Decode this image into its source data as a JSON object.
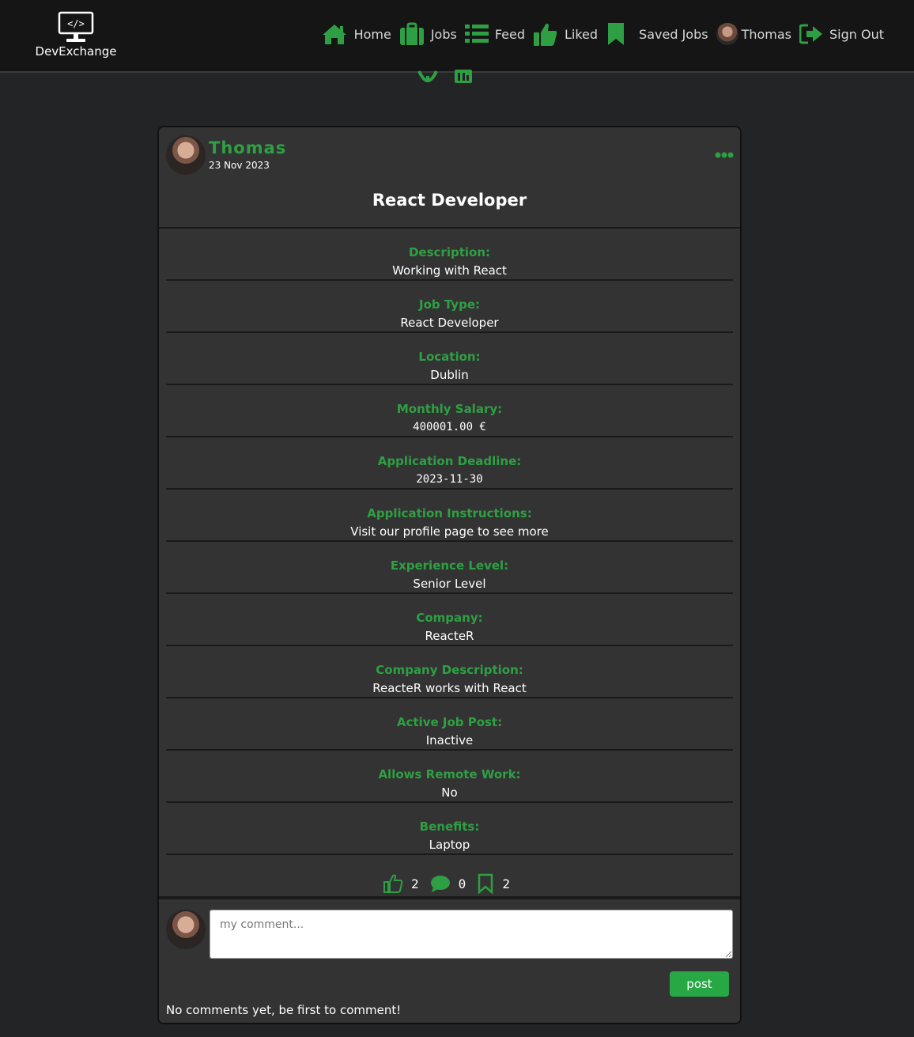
{
  "brand": {
    "name": "DevExchange",
    "logo_icon": "monitor-code-icon"
  },
  "nav": {
    "home": "Home",
    "jobs": "Jobs",
    "feed": "Feed",
    "liked": "Liked",
    "saved_jobs": "Saved Jobs",
    "profile": "Thomas",
    "sign_out": "Sign Out"
  },
  "colors": {
    "accent": "#2ea043",
    "navbar": "#151515",
    "card": "#333333",
    "page": "#232426"
  },
  "post": {
    "author": "Thomas",
    "date": "23 Nov 2023",
    "title": "React Developer",
    "fields": [
      {
        "label": "Description:",
        "value": "Working with React"
      },
      {
        "label": "Job Type:",
        "value": "React Developer"
      },
      {
        "label": "Location:",
        "value": "Dublin"
      },
      {
        "label": "Monthly Salary:",
        "value": "400001.00 €"
      },
      {
        "label": "Application Deadline:",
        "value": "2023-11-30"
      },
      {
        "label": "Application Instructions:",
        "value": "Visit our profile page to see more"
      },
      {
        "label": "Experience Level:",
        "value": "Senior Level"
      },
      {
        "label": "Company:",
        "value": "ReacteR"
      },
      {
        "label": "Company Description:",
        "value": "ReacteR works with React"
      },
      {
        "label": "Active Job Post:",
        "value": "Inactive"
      },
      {
        "label": "Allows Remote Work:",
        "value": "No"
      },
      {
        "label": "Benefits:",
        "value": "Laptop"
      }
    ],
    "likes": "2",
    "comments": "0",
    "saves": "2"
  },
  "comment_form": {
    "placeholder": "my comment...",
    "submit_label": "post"
  },
  "comments_empty": "No comments yet, be first to comment!"
}
